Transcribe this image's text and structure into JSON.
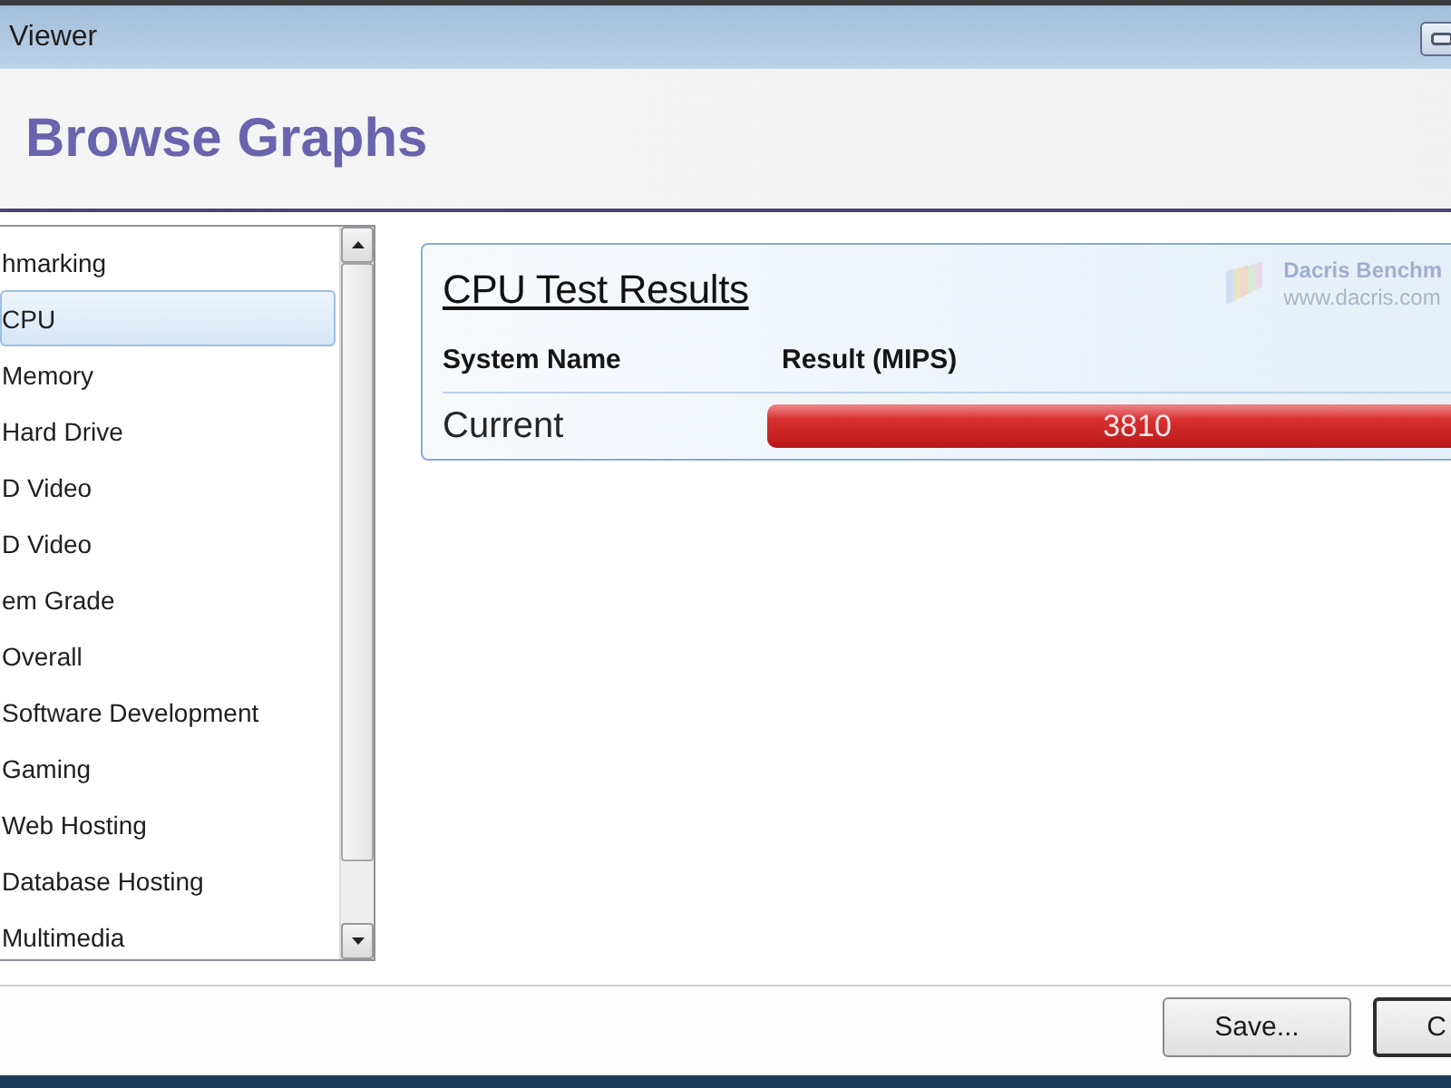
{
  "window": {
    "title": "Viewer",
    "heading": "Browse Graphs"
  },
  "sidebar": {
    "items": [
      {
        "label": "hmarking",
        "selected": false
      },
      {
        "label": "CPU",
        "selected": true
      },
      {
        "label": "Memory",
        "selected": false
      },
      {
        "label": "Hard Drive",
        "selected": false
      },
      {
        "label": "D Video",
        "selected": false
      },
      {
        "label": "D Video",
        "selected": false
      },
      {
        "label": "em Grade",
        "selected": false
      },
      {
        "label": "Overall",
        "selected": false
      },
      {
        "label": "Software Development",
        "selected": false
      },
      {
        "label": "Gaming",
        "selected": false
      },
      {
        "label": "Web Hosting",
        "selected": false
      },
      {
        "label": "Database Hosting",
        "selected": false
      },
      {
        "label": "Multimedia",
        "selected": false
      }
    ]
  },
  "results": {
    "logo": {
      "name": "Dacris Benchm",
      "url": "www.dacris.com"
    },
    "columns": [
      "System Name",
      "Result (MIPS)"
    ],
    "chart_data": {
      "type": "bar",
      "title": "CPU Test Results",
      "orientation": "horizontal",
      "categories": [
        "Current"
      ],
      "values": [
        3810
      ],
      "data_labels": true
    }
  },
  "buttons": [
    {
      "label": "Save...",
      "default": false
    },
    {
      "label": "C",
      "default": true
    }
  ]
}
